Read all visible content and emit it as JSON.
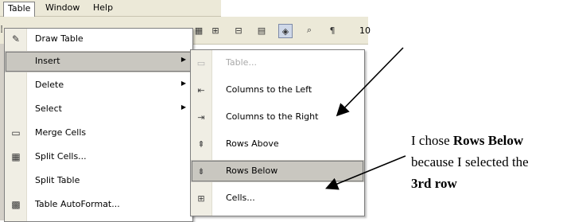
{
  "menubar": {
    "items": [
      {
        "label": "Table"
      },
      {
        "label": "Window"
      },
      {
        "label": "Help"
      }
    ]
  },
  "toolbar": {
    "font_size_value": "10",
    "icons": [
      "pencil-icon",
      "insert-table-icon",
      "columns-icon",
      "merge-icon",
      "table-view-icon",
      "shading-icon",
      "zoom-icon",
      "pilcrow-icon"
    ]
  },
  "table_menu": {
    "items": [
      {
        "label": "Draw Table",
        "icon": "pencil-icon"
      },
      {
        "label": "Insert",
        "has_submenu": true,
        "highlighted": true
      },
      {
        "label": "Delete",
        "has_submenu": true
      },
      {
        "label": "Select",
        "has_submenu": true
      },
      {
        "label": "Merge Cells",
        "icon": "merge-cells-icon"
      },
      {
        "label": "Split Cells...",
        "icon": "split-cells-icon"
      },
      {
        "label": "Split Table"
      },
      {
        "label": "Table AutoFormat...",
        "icon": "autoformat-icon"
      }
    ]
  },
  "insert_menu": {
    "items": [
      {
        "label": "Table...",
        "disabled": true,
        "icon": "table-icon"
      },
      {
        "label": "Columns to the Left",
        "icon": "columns-left-icon"
      },
      {
        "label": "Columns to the Right",
        "icon": "columns-right-icon"
      },
      {
        "label": "Rows Above",
        "icon": "rows-above-icon"
      },
      {
        "label": "Rows Below",
        "icon": "rows-below-icon",
        "highlighted": true
      },
      {
        "label": "Cells...",
        "icon": "cells-icon"
      }
    ]
  },
  "annotation": {
    "line1_prefix": "I chose ",
    "line1_bold": "Rows Below",
    "line2": "because I selected the",
    "line3_bold": "3rd row"
  },
  "colors": {
    "menu_background": "#ffffff",
    "highlight": "#c9c7c0",
    "disabled_text": "#a8a8a8",
    "chrome": "#ece9d8"
  }
}
